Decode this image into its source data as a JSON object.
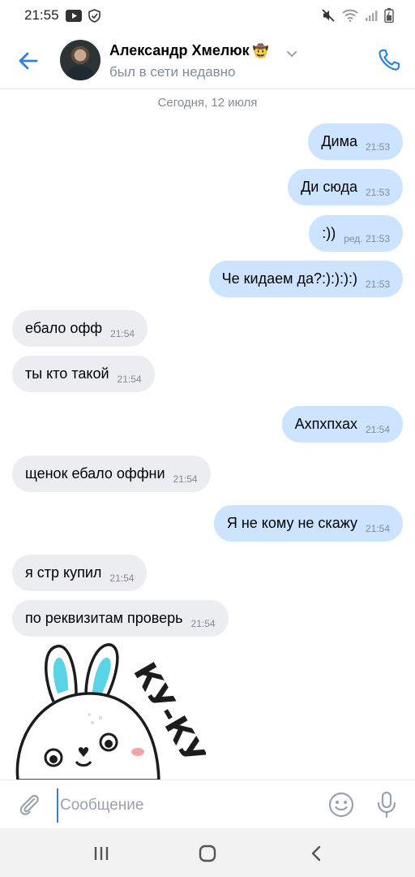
{
  "status_bar": {
    "time": "21:55",
    "icons": [
      "youtube-icon",
      "shield-icon",
      "mute-icon",
      "wifi-icon",
      "signal-icon",
      "battery-icon"
    ]
  },
  "header": {
    "contact_name": "Александр Хмелюк",
    "name_emoji": "🤠",
    "status": "был в сети недавно",
    "icons": [
      "back-arrow-icon",
      "chevron-down-icon",
      "phone-icon"
    ]
  },
  "date_separator": "Сегодня, 12 июля",
  "messages": [
    {
      "direction": "out",
      "text": "Дима",
      "time": "21:53"
    },
    {
      "direction": "out",
      "text": "Ди сюда",
      "time": "21:53"
    },
    {
      "direction": "out",
      "text": ":))",
      "time": "ред. 21:53"
    },
    {
      "direction": "out",
      "text": "Че кидаем да?:):):):)",
      "time": "21:53"
    },
    {
      "direction": "in",
      "text": "ебало офф",
      "time": "21:54"
    },
    {
      "direction": "in",
      "text": "ты кто такой",
      "time": "21:54"
    },
    {
      "direction": "out",
      "text": "Ахпхпхах",
      "time": "21:54"
    },
    {
      "direction": "in",
      "text": "щенок ебало оффни",
      "time": "21:54"
    },
    {
      "direction": "out",
      "text": "Я не кому не скажу",
      "time": "21:54"
    },
    {
      "direction": "in",
      "text": "я стр купил",
      "time": "21:54"
    },
    {
      "direction": "in",
      "text": "по реквизитам проверь",
      "time": "21:54"
    }
  ],
  "sticker": {
    "text": "КУ-КУ",
    "colors": {
      "ears": "#5bd3e6",
      "outline": "#1c1c1c",
      "cheeks": "#f7a4a8"
    }
  },
  "composer": {
    "placeholder": "Сообщение",
    "value": "",
    "icons": [
      "paperclip-icon",
      "smile-icon",
      "microphone-icon"
    ]
  },
  "nav_bar": {
    "icons": [
      "recent-apps-icon",
      "home-icon",
      "back-icon"
    ]
  },
  "colors": {
    "accent": "#2d81e0",
    "outgoing_bubble": "#cce4ff",
    "incoming_bubble": "#ebedf0",
    "secondary_text": "#818c99"
  }
}
